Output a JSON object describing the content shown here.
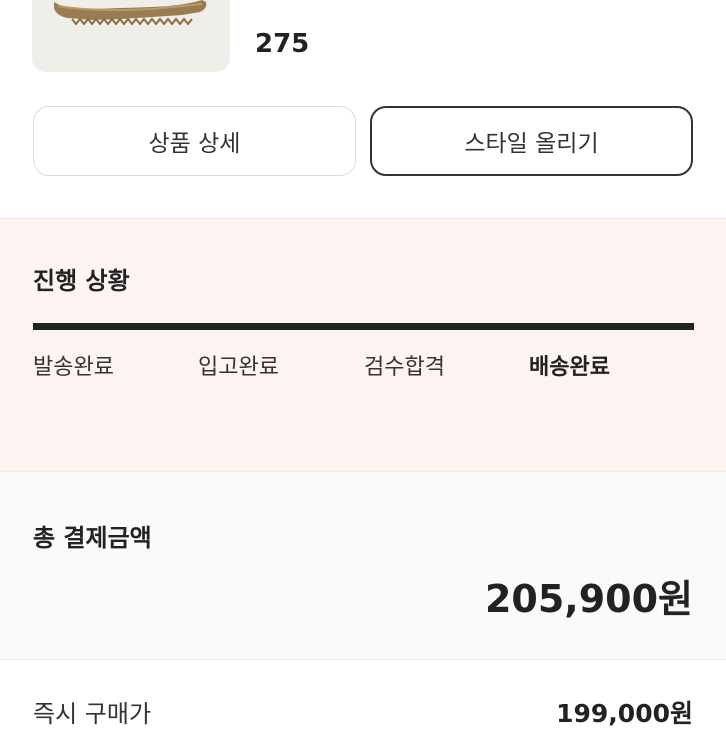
{
  "product": {
    "image_icon": "product-thumbnail-image",
    "size": "275"
  },
  "actions": {
    "detail_label": "상품 상세",
    "style_label": "스타일 올리기"
  },
  "progress": {
    "title": "진행 상황",
    "steps": [
      "발송완료",
      "입고완료",
      "검수합격",
      "배송완료"
    ],
    "current_step": "배송완료",
    "bar_fill": 1.0
  },
  "payment": {
    "title": "총 결제금액",
    "amount": "205,900원"
  },
  "details": [
    {
      "label": "즉시 구매가",
      "value": "199,000원"
    }
  ],
  "colors": {
    "progress_bg": "#fdf4f2",
    "payment_bg": "#fafafa",
    "bar": "#222222"
  }
}
